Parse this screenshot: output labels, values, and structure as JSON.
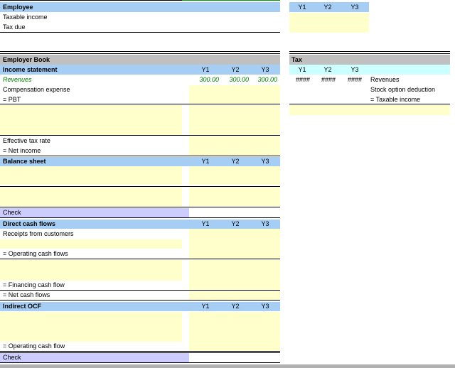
{
  "years": [
    "Y1",
    "Y2",
    "Y3"
  ],
  "employee": {
    "title": "Employee",
    "rows": [
      "Taxable income",
      "Tax due"
    ]
  },
  "employer": {
    "book_title": "Employer Book",
    "income": {
      "title": "Income statement",
      "revenues_label": "Revenues",
      "revenues": [
        "300.00",
        "300.00",
        "300.00"
      ],
      "comp_label": "Compensation expense",
      "pbt_label": "= PBT",
      "etr_label": "Effective tax rate",
      "net_income_label": "= Net income"
    },
    "balance": {
      "title": "Balance sheet",
      "check_label": "Check"
    },
    "direct": {
      "title": "Direct cash flows",
      "receipts_label": "Receipts from customers",
      "ocf_label": "= Operating cash flows",
      "financing_label": "= Financing cash flow",
      "net_label": "= Net cash flows"
    },
    "indirect": {
      "title": "Indirect OCF",
      "ocf_label": "= Operating cash flow",
      "check_label": "Check"
    }
  },
  "tax": {
    "title": "Tax",
    "values": [
      "####",
      "####",
      "####"
    ],
    "revenues_label": "Revenues",
    "stock_label": "Stock option deduction",
    "taxable_label": "= Taxable income"
  },
  "colors": {
    "header_blue": "#a6cef5",
    "input_yellow": "#ffffcc",
    "book_gray": "#c0c0c0",
    "check_purple": "#ccccff",
    "tax_cyan": "#ccffff",
    "revenue_green": "#008000"
  }
}
